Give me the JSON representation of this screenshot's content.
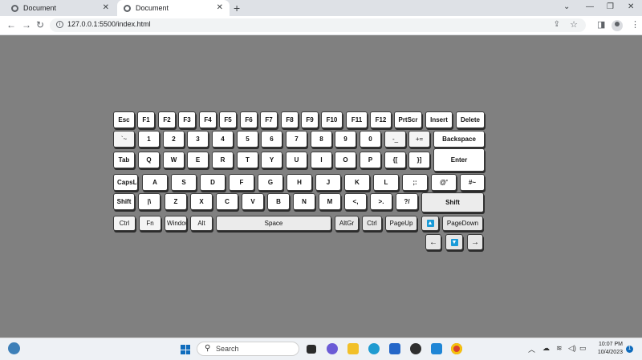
{
  "browser": {
    "tabs": [
      {
        "label": "Document"
      },
      {
        "label": "Document"
      }
    ],
    "url": "127.0.0.1:5500/index.html"
  },
  "keyboard": {
    "rows": [
      [
        "Esc",
        "F1",
        "F2",
        "F3",
        "F4",
        "F5",
        "F6",
        "F7",
        "F8",
        "F9",
        "F10",
        "F11",
        "F12",
        "PrtScr",
        "Insert",
        "Delete"
      ],
      [
        "`~",
        "1",
        "2",
        "3",
        "4",
        "5",
        "6",
        "7",
        "8",
        "9",
        "0",
        "-_",
        "+=",
        "Backspace"
      ],
      [
        "Tab",
        "Q",
        "W",
        "E",
        "R",
        "T",
        "Y",
        "U",
        "I",
        "O",
        "P",
        "{[",
        "}]",
        "Enter"
      ],
      [
        "CapsLock",
        "A",
        "S",
        "D",
        "F",
        "G",
        "H",
        "J",
        "K",
        "L",
        ";:",
        "@'",
        "#~"
      ],
      [
        "Shift",
        "|\\",
        "Z",
        "X",
        "C",
        "V",
        "B",
        "N",
        "M",
        "<,",
        ">.",
        "?/",
        "Shift"
      ],
      [
        "Ctrl",
        "Fn",
        "Windows",
        "Alt",
        "Space",
        "AltGr",
        "Ctrl",
        "PageUp",
        "▲",
        "PageDown"
      ],
      [
        "←",
        "▼",
        "→"
      ]
    ]
  },
  "taskbar": {
    "search_placeholder": "Search",
    "time": "10:07 PM",
    "date": "10/4/2023",
    "notification_count": "1"
  }
}
